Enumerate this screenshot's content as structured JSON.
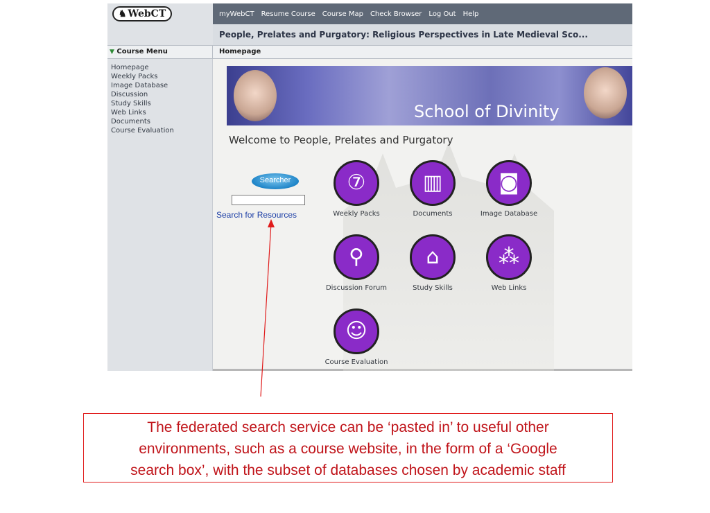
{
  "webct": {
    "logo_text": "WebCT",
    "nav": [
      "myWebCT",
      "Resume Course",
      "Course Map",
      "Check Browser",
      "Log Out",
      "Help"
    ],
    "course_title": "People, Prelates and Purgatory: Religious Perspectives in Late Medieval Sco...",
    "menu_header": "Course Menu",
    "page_name": "Homepage",
    "menu_items": [
      "Homepage",
      "Weekly Packs",
      "Image Database",
      "Discussion",
      "Study Skills",
      "Web Links",
      "Documents",
      "Course Evaluation"
    ]
  },
  "content": {
    "banner_title": "School of Divinity",
    "welcome": "Welcome to People, Prelates and Purgatory",
    "searcher_logo": "Searcher",
    "search_link": "Search for Resources",
    "tiles": [
      {
        "label": "Weekly Packs",
        "icon": "numbers-icon"
      },
      {
        "label": "Documents",
        "icon": "books-icon"
      },
      {
        "label": "Image Database",
        "icon": "camera-icon"
      },
      {
        "label": "Discussion Forum",
        "icon": "pin-icon"
      },
      {
        "label": "Study Skills",
        "icon": "house-icon"
      },
      {
        "label": "Web Links",
        "icon": "network-icon"
      },
      {
        "label": "Course Evaluation",
        "icon": "reader-icon"
      }
    ]
  },
  "annotation": {
    "lines": [
      "The federated search service can be ‘pasted in’ to useful other",
      "environments, such as a course website, in the form of a ‘Google",
      "search box’, with the subset of databases chosen by academic staff"
    ],
    "color": "#c0141a"
  },
  "colors": {
    "accent_purple": "#8a2bc8",
    "topbar": "#5f6977"
  }
}
